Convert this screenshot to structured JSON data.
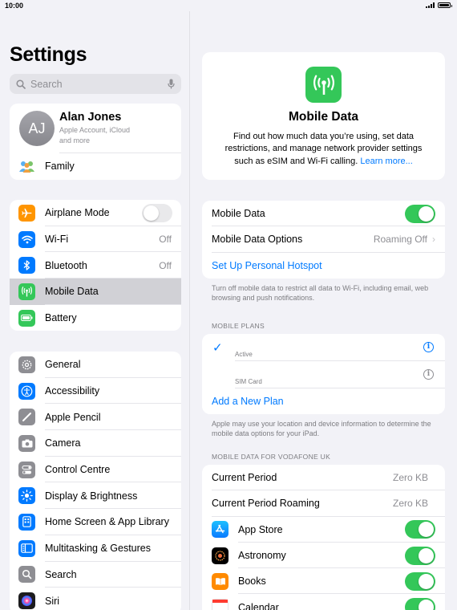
{
  "status_bar": {
    "time": "10:00"
  },
  "sidebar": {
    "title": "Settings",
    "search": {
      "placeholder": "Search"
    },
    "profile": {
      "initials": "AJ",
      "name": "Alan Jones",
      "subtitle_1": "Apple Account, iCloud",
      "subtitle_2": "and more"
    },
    "family": {
      "label": "Family"
    },
    "connectivity": [
      {
        "label": "Airplane Mode",
        "toggle": "off"
      },
      {
        "label": "Wi-Fi",
        "value": "Off"
      },
      {
        "label": "Bluetooth",
        "value": "Off"
      },
      {
        "label": "Mobile Data",
        "selected": true
      },
      {
        "label": "Battery"
      }
    ],
    "general": [
      {
        "label": "General"
      },
      {
        "label": "Accessibility"
      },
      {
        "label": "Apple Pencil"
      },
      {
        "label": "Camera"
      },
      {
        "label": "Control Centre"
      },
      {
        "label": "Display & Brightness"
      },
      {
        "label": "Home Screen & App Library"
      },
      {
        "label": "Multitasking & Gestures"
      },
      {
        "label": "Search"
      },
      {
        "label": "Siri"
      }
    ]
  },
  "detail": {
    "hero": {
      "title": "Mobile Data",
      "description": "Find out how much data you’re using, set data restrictions, and manage network provider settings such as eSIM and Wi-Fi calling.",
      "link": "Learn more..."
    },
    "main": {
      "mobile_data": {
        "label": "Mobile Data",
        "toggle": "on"
      },
      "options": {
        "label": "Mobile Data Options",
        "value": "Roaming Off"
      },
      "hotspot": {
        "label": "Set Up Personal Hotspot"
      }
    },
    "main_note": "Turn off mobile data to restrict all data to Wi-Fi, including email, web browsing and push notifications.",
    "plans_header": "MOBILE PLANS",
    "plans": [
      {
        "status": "Active",
        "checked": true
      },
      {
        "status": "SIM Card",
        "checked": false
      }
    ],
    "add_plan": "Add a New Plan",
    "plans_note": "Apple may use your location and device information to determine the mobile data options for your iPad.",
    "usage_header": "MOBILE DATA FOR VODAFONE UK",
    "usage": {
      "current_period": {
        "label": "Current Period",
        "value": "Zero KB"
      },
      "current_roaming": {
        "label": "Current Period Roaming",
        "value": "Zero KB"
      }
    },
    "apps": [
      {
        "label": "App Store",
        "toggle": "on"
      },
      {
        "label": "Astronomy",
        "toggle": "on"
      },
      {
        "label": "Books",
        "toggle": "on"
      },
      {
        "label": "Calendar",
        "toggle": "on"
      }
    ]
  },
  "colors": {
    "accent": "#007aff",
    "switch_on": "#34c759",
    "selected_row": "#d1d1d6"
  }
}
